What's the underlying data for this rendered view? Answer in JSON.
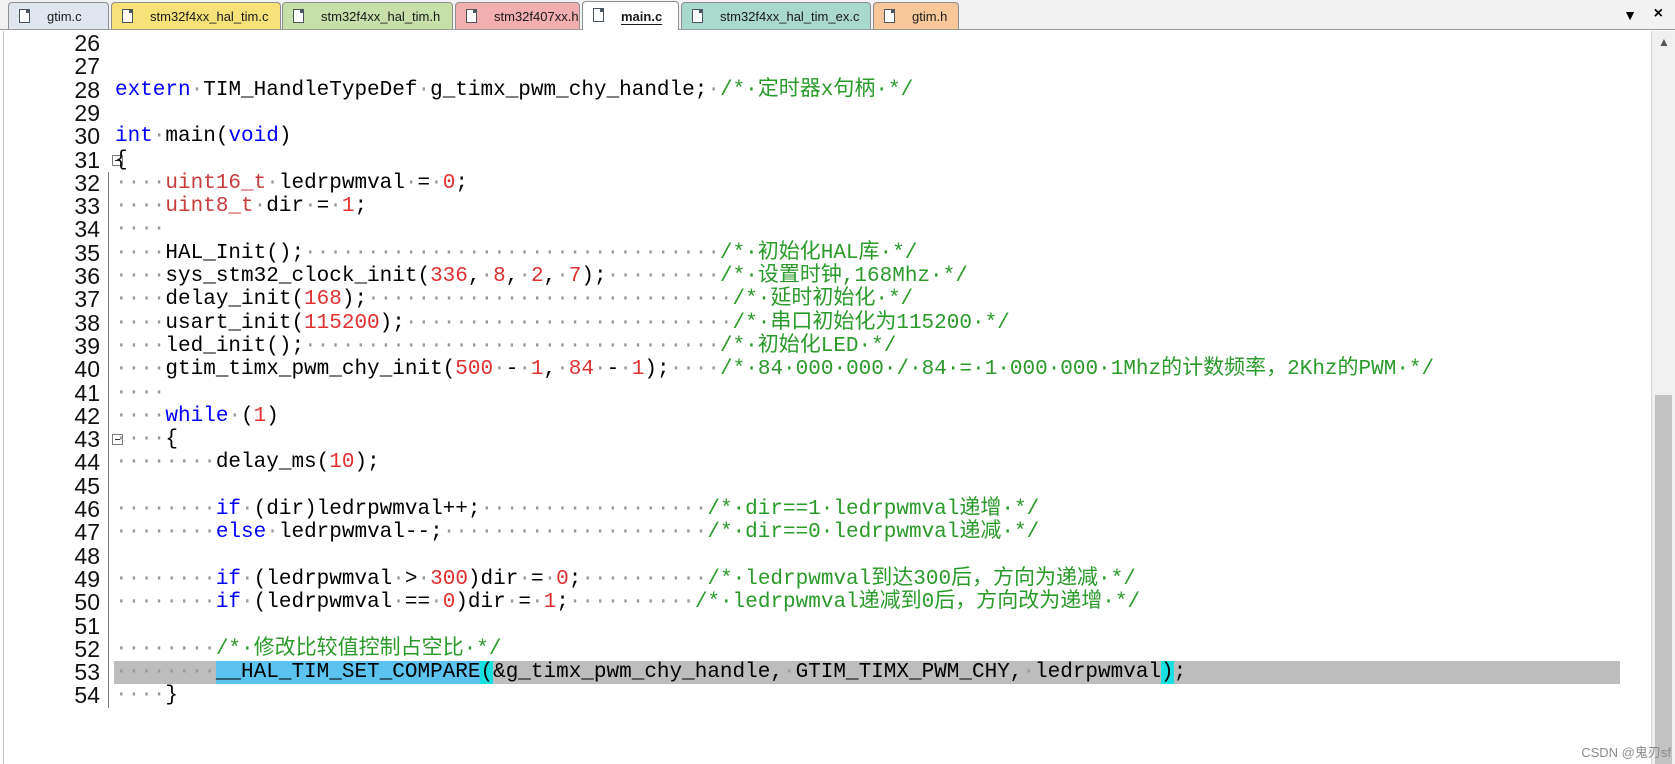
{
  "tabs": [
    {
      "label": "gtim.c",
      "color": "#dfe6f0",
      "active": false
    },
    {
      "label": "stm32f4xx_hal_tim.c",
      "color": "#f7e27a",
      "active": false
    },
    {
      "label": "stm32f4xx_hal_tim.h",
      "color": "#c7dfa8",
      "active": false
    },
    {
      "label": "stm32f407xx.h",
      "color": "#f3aeb0",
      "active": false
    },
    {
      "label": "main.c",
      "color": "#ffffff",
      "active": true
    },
    {
      "label": "stm32f4xx_hal_tim_ex.c",
      "color": "#a9d9cd",
      "active": false
    },
    {
      "label": "gtim.h",
      "color": "#f9c89a",
      "active": false
    }
  ],
  "tab_dropdown_glyph": "▼",
  "tab_close_glyph": "×",
  "editor": {
    "lines": [
      {
        "n": "26",
        "segs": []
      },
      {
        "n": "27",
        "segs": []
      },
      {
        "n": "28",
        "segs": [
          [
            "kw",
            "extern"
          ],
          [
            "dot",
            "·"
          ],
          [
            "",
            "TIM_HandleTypeDef"
          ],
          [
            "dot",
            "·"
          ],
          [
            "",
            "g_timx_pwm_chy_handle;"
          ],
          [
            "dot",
            "·"
          ],
          [
            "cm",
            "/*·定时器x句柄·*/"
          ]
        ]
      },
      {
        "n": "29",
        "segs": []
      },
      {
        "n": "30",
        "segs": [
          [
            "kw",
            "int"
          ],
          [
            "dot",
            "·"
          ],
          [
            "",
            "main("
          ],
          [
            "kw",
            "void"
          ],
          [
            "",
            ")"
          ]
        ]
      },
      {
        "n": "31",
        "fold": true,
        "segs": [
          [
            "",
            "{"
          ]
        ]
      },
      {
        "n": "32",
        "segs": [
          [
            "dot",
            "····"
          ],
          [
            "ty",
            "uint16_t"
          ],
          [
            "dot",
            "·"
          ],
          [
            "",
            "ledrpwmval"
          ],
          [
            "dot",
            "·"
          ],
          [
            "",
            "="
          ],
          [
            "dot",
            "·"
          ],
          [
            "num",
            "0"
          ],
          [
            "",
            ";"
          ]
        ]
      },
      {
        "n": "33",
        "segs": [
          [
            "dot",
            "····"
          ],
          [
            "ty",
            "uint8_t"
          ],
          [
            "dot",
            "·"
          ],
          [
            "",
            "dir"
          ],
          [
            "dot",
            "·"
          ],
          [
            "",
            "="
          ],
          [
            "dot",
            "·"
          ],
          [
            "num",
            "1"
          ],
          [
            "",
            ";"
          ]
        ]
      },
      {
        "n": "34",
        "segs": [
          [
            "dot",
            "····"
          ]
        ]
      },
      {
        "n": "35",
        "segs": [
          [
            "dot",
            "····"
          ],
          [
            "",
            "HAL_Init();"
          ],
          [
            "dot",
            "·································"
          ],
          [
            "cm",
            "/*·初始化HAL库·*/"
          ]
        ]
      },
      {
        "n": "36",
        "segs": [
          [
            "dot",
            "····"
          ],
          [
            "",
            "sys_stm32_clock_init("
          ],
          [
            "num",
            "336"
          ],
          [
            "",
            ","
          ],
          [
            "dot",
            "·"
          ],
          [
            "num",
            "8"
          ],
          [
            "",
            ","
          ],
          [
            "dot",
            "·"
          ],
          [
            "num",
            "2"
          ],
          [
            "",
            ","
          ],
          [
            "dot",
            "·"
          ],
          [
            "num",
            "7"
          ],
          [
            "",
            ");"
          ],
          [
            "dot",
            "·········"
          ],
          [
            "cm",
            "/*·设置时钟,168Mhz·*/"
          ]
        ]
      },
      {
        "n": "37",
        "segs": [
          [
            "dot",
            "····"
          ],
          [
            "",
            "delay_init("
          ],
          [
            "num",
            "168"
          ],
          [
            "",
            ");"
          ],
          [
            "dot",
            "·····························"
          ],
          [
            "cm",
            "/*·延时初始化·*/"
          ]
        ]
      },
      {
        "n": "38",
        "segs": [
          [
            "dot",
            "····"
          ],
          [
            "",
            "usart_init("
          ],
          [
            "num",
            "115200"
          ],
          [
            "",
            ");"
          ],
          [
            "dot",
            "··························"
          ],
          [
            "cm",
            "/*·串口初始化为115200·*/"
          ]
        ]
      },
      {
        "n": "39",
        "segs": [
          [
            "dot",
            "····"
          ],
          [
            "",
            "led_init();"
          ],
          [
            "dot",
            "·································"
          ],
          [
            "cm",
            "/*·初始化LED·*/"
          ]
        ]
      },
      {
        "n": "40",
        "segs": [
          [
            "dot",
            "····"
          ],
          [
            "",
            "gtim_timx_pwm_chy_init("
          ],
          [
            "num",
            "500"
          ],
          [
            "dot",
            "·"
          ],
          [
            "",
            "-"
          ],
          [
            "dot",
            "·"
          ],
          [
            "num",
            "1"
          ],
          [
            "",
            ","
          ],
          [
            "dot",
            "·"
          ],
          [
            "num",
            "84"
          ],
          [
            "dot",
            "·"
          ],
          [
            "",
            "-"
          ],
          [
            "dot",
            "·"
          ],
          [
            "num",
            "1"
          ],
          [
            "",
            ");"
          ],
          [
            "dot",
            "····"
          ],
          [
            "cm",
            "/*·84·000·000·/·84·=·1·000·000·1Mhz的计数频率，2Khz的PWM·*/"
          ]
        ]
      },
      {
        "n": "41",
        "segs": [
          [
            "dot",
            "····"
          ]
        ]
      },
      {
        "n": "42",
        "segs": [
          [
            "dot",
            "····"
          ],
          [
            "kw",
            "while"
          ],
          [
            "dot",
            "·"
          ],
          [
            "",
            "("
          ],
          [
            "num",
            "1"
          ],
          [
            "",
            ")"
          ]
        ]
      },
      {
        "n": "43",
        "fold": true,
        "segs": [
          [
            "dot",
            "····"
          ],
          [
            "",
            "{"
          ]
        ]
      },
      {
        "n": "44",
        "segs": [
          [
            "dot",
            "········"
          ],
          [
            "",
            "delay_ms("
          ],
          [
            "num",
            "10"
          ],
          [
            "",
            ");"
          ]
        ]
      },
      {
        "n": "45",
        "segs": []
      },
      {
        "n": "46",
        "segs": [
          [
            "dot",
            "········"
          ],
          [
            "kw",
            "if"
          ],
          [
            "dot",
            "·"
          ],
          [
            "",
            "(dir)ledrpwmval++;"
          ],
          [
            "dot",
            "··················"
          ],
          [
            "cm",
            "/*·dir==1·ledrpwmval递增·*/"
          ]
        ]
      },
      {
        "n": "47",
        "segs": [
          [
            "dot",
            "········"
          ],
          [
            "kw",
            "else"
          ],
          [
            "dot",
            "·"
          ],
          [
            "",
            "ledrpwmval--;"
          ],
          [
            "dot",
            "·····················"
          ],
          [
            "cm",
            "/*·dir==0·ledrpwmval递减·*/"
          ]
        ]
      },
      {
        "n": "48",
        "segs": []
      },
      {
        "n": "49",
        "segs": [
          [
            "dot",
            "········"
          ],
          [
            "kw",
            "if"
          ],
          [
            "dot",
            "·"
          ],
          [
            "",
            "(ledrpwmval"
          ],
          [
            "dot",
            "·"
          ],
          [
            "",
            ">"
          ],
          [
            "dot",
            "·"
          ],
          [
            "num",
            "300"
          ],
          [
            "",
            ")dir"
          ],
          [
            "dot",
            "·"
          ],
          [
            "",
            "="
          ],
          [
            "dot",
            "·"
          ],
          [
            "num",
            "0"
          ],
          [
            "",
            ";"
          ],
          [
            "dot",
            "··········"
          ],
          [
            "cm",
            "/*·ledrpwmval到达300后，方向为递减·*/"
          ]
        ]
      },
      {
        "n": "50",
        "segs": [
          [
            "dot",
            "········"
          ],
          [
            "kw",
            "if"
          ],
          [
            "dot",
            "·"
          ],
          [
            "",
            "(ledrpwmval"
          ],
          [
            "dot",
            "·"
          ],
          [
            "",
            "=="
          ],
          [
            "dot",
            "·"
          ],
          [
            "num",
            "0"
          ],
          [
            "",
            ")dir"
          ],
          [
            "dot",
            "·"
          ],
          [
            "",
            "="
          ],
          [
            "dot",
            "·"
          ],
          [
            "num",
            "1"
          ],
          [
            "",
            ";"
          ],
          [
            "dot",
            "··········"
          ],
          [
            "cm",
            "/*·ledrpwmval递减到0后，方向改为递增·*/"
          ]
        ]
      },
      {
        "n": "51",
        "segs": []
      },
      {
        "n": "52",
        "segs": [
          [
            "dot",
            "········"
          ],
          [
            "cm",
            "/*·修改比较值控制占空比·*/"
          ]
        ]
      },
      {
        "n": "53",
        "highlight": true,
        "segs": [
          [
            "dot",
            "········"
          ],
          [
            "sel",
            "__HAL_TIM_SET_COMPARE"
          ],
          [
            "brace",
            "("
          ],
          [
            "",
            "&g_timx_pwm_chy_handle,"
          ],
          [
            "dot",
            "·"
          ],
          [
            "",
            "GTIM_TIMX_PWM_CHY,"
          ],
          [
            "dot",
            "·"
          ],
          [
            "",
            "ledrpwmval"
          ],
          [
            "brace",
            ")"
          ],
          [
            "",
            ";"
          ]
        ]
      },
      {
        "n": "54",
        "segs": [
          [
            "dot",
            "····"
          ],
          [
            "",
            "}"
          ]
        ]
      }
    ]
  },
  "watermark": "CSDN @鬼刃sf"
}
